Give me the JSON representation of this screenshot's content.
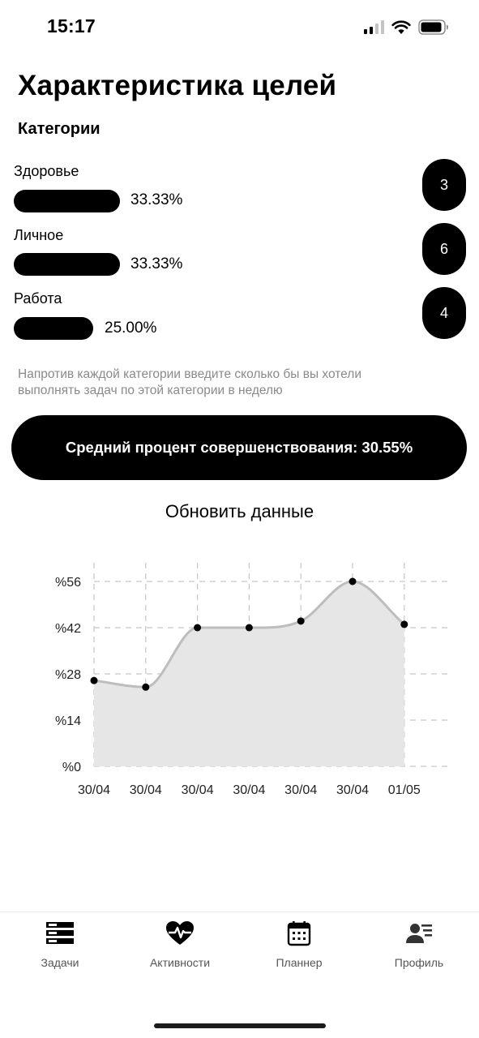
{
  "status_bar": {
    "time": "15:17"
  },
  "page_title": "Характеристика целей",
  "section_title": "Категории",
  "categories": [
    {
      "label": "Здоровье",
      "percent_text": "33.33%",
      "count": "3",
      "percent": 33.33
    },
    {
      "label": "Личное",
      "percent_text": "33.33%",
      "count": "6",
      "percent": 33.33
    },
    {
      "label": "Работа",
      "percent_text": "25.00%",
      "count": "4",
      "percent": 25.0
    }
  ],
  "hint": "Напротив каждой категории введите сколько бы вы хотели выполнять задач по этой категории в неделю",
  "average_button": "Средний процент совершенствования: 30.55%",
  "refresh_link": "Обновить данные",
  "chart_data": {
    "type": "area",
    "categories": [
      "30/04",
      "30/04",
      "30/04",
      "30/04",
      "30/04",
      "30/04",
      "01/05"
    ],
    "values": [
      26,
      24,
      42,
      42,
      44,
      56,
      43
    ],
    "y_ticks": [
      "%0",
      "%14",
      "%28",
      "%42",
      "%56"
    ],
    "ylim": [
      0,
      56
    ],
    "grid": true,
    "colors": {
      "line": "#bdbdbd",
      "fill": "#e6e6e6",
      "point": "#000000",
      "grid": "#c6c6c6"
    }
  },
  "tabs": [
    {
      "label": "Задачи",
      "icon": "tasks-icon"
    },
    {
      "label": "Активности",
      "icon": "heart-activity-icon"
    },
    {
      "label": "Планнер",
      "icon": "calendar-icon"
    },
    {
      "label": "Профиль",
      "icon": "profile-icon"
    }
  ]
}
